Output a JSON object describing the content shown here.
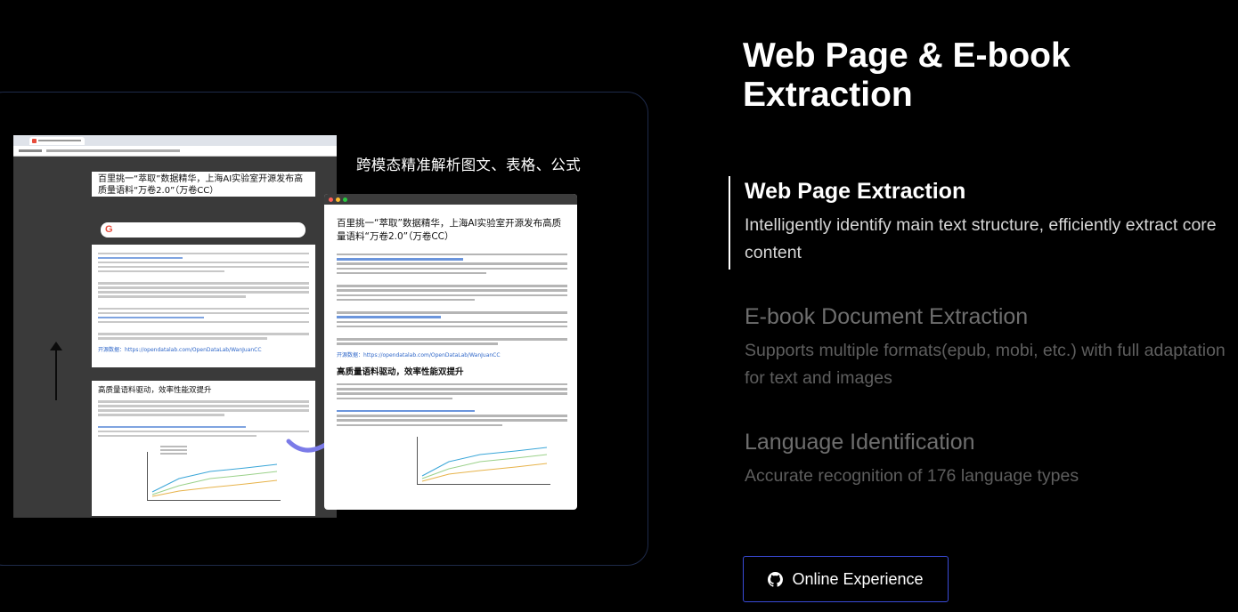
{
  "demo": {
    "caption": "跨模态精准解析图文、表格、公式",
    "source_title": "百里挑一“萃取”数据精华，上海AI实验室开源发布高质量语料“万卷2.0”（万卷CC）",
    "parsed_title": "百里挑一“萃取”数据精华，上海AI实验室开源发布高质量语料“万卷2.0”（万卷CC）",
    "parsed_section_heading": "高质量语料驱动，效率性能双提升",
    "source_section_heading": "高质量语料驱动，效率性能双提升",
    "source_link": "开源数据：https://opendatalab.com/OpenDataLab/WanJuanCC",
    "parsed_link": "开源数据：https://opendatalab.com/OpenDataLab/WanJuanCC"
  },
  "panel": {
    "title": "Web Page & E-book Extraction",
    "features": [
      {
        "title": "Web Page Extraction",
        "description": "Intelligently identify main text structure, efficiently extract core content",
        "active": true
      },
      {
        "title": "E-book Document Extraction",
        "description": "Supports multiple formats(epub, mobi, etc.) with full adaptation for text and images",
        "active": false
      },
      {
        "title": "Language Identification",
        "description": "Accurate recognition of 176 language types",
        "active": false
      }
    ],
    "cta_label": "Online Experience",
    "cta_icon": "github-icon"
  },
  "colors": {
    "background": "#000000",
    "accent_border": "#3a4bd8",
    "frame_border": "#1e2a4a",
    "link_blue": "#2f67c9"
  }
}
